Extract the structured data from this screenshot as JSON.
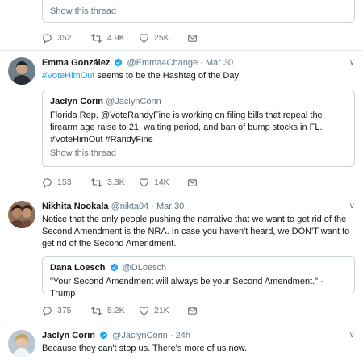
{
  "feed": {
    "top": {
      "quote_thread_label": "Show this thread",
      "actions": {
        "replies": "352",
        "retweets": "4.9K",
        "likes": "25K"
      }
    },
    "tweets": [
      {
        "name": "Emma González",
        "handle": "@Emma4Change",
        "date": "Mar 30",
        "text_hashtag": "#VoteHimOut",
        "text_rest": " seems to be the Hashtag of the Day",
        "quote": {
          "name": "Jaclyn Corin",
          "handle": "@JaclynCorin",
          "text": "Florida Rep. @VoteRandyFine is working on filing bills that repeal the firearm age raise to 21, waiting period, and ban of bump stocks in FL. #VoteHimOut #RandyFine",
          "thread_label": "Show this thread"
        },
        "actions": {
          "replies": "153",
          "retweets": "3.3K",
          "likes": "14K"
        }
      },
      {
        "name": "Nikhita Nookala",
        "handle": "@nikta04",
        "date": "Mar 30",
        "text": "Notice that the only people pushing the narrative that we want to get rid of the Second Amendment is the NRA. In case you haven't heard, we DON'T want to get rid of the Second Amendment.",
        "quote": {
          "name": "Dana Loesch",
          "handle": "@DLoesch",
          "text": "\"Your Second Amendment will always be your Second Amendment.\" - Trump"
        },
        "actions": {
          "replies": "375",
          "retweets": "5.2K",
          "likes": "21K"
        }
      },
      {
        "name": "Jaclyn Corin",
        "handle": "@JaclynCorin",
        "date": "24h",
        "text": "Because they can't stop us. There's more of us now."
      }
    ],
    "meta_separator": " · "
  },
  "colors": {
    "accent": "#1da1f2",
    "muted": "#657786",
    "border": "#e6ecf0",
    "verified": "#1da1f2"
  },
  "icons": {
    "reply": "reply-icon",
    "retweet": "retweet-icon",
    "like": "heart-icon",
    "dm": "envelope-icon",
    "verified": "verified-badge-icon",
    "caret": "chevron-down-icon"
  }
}
